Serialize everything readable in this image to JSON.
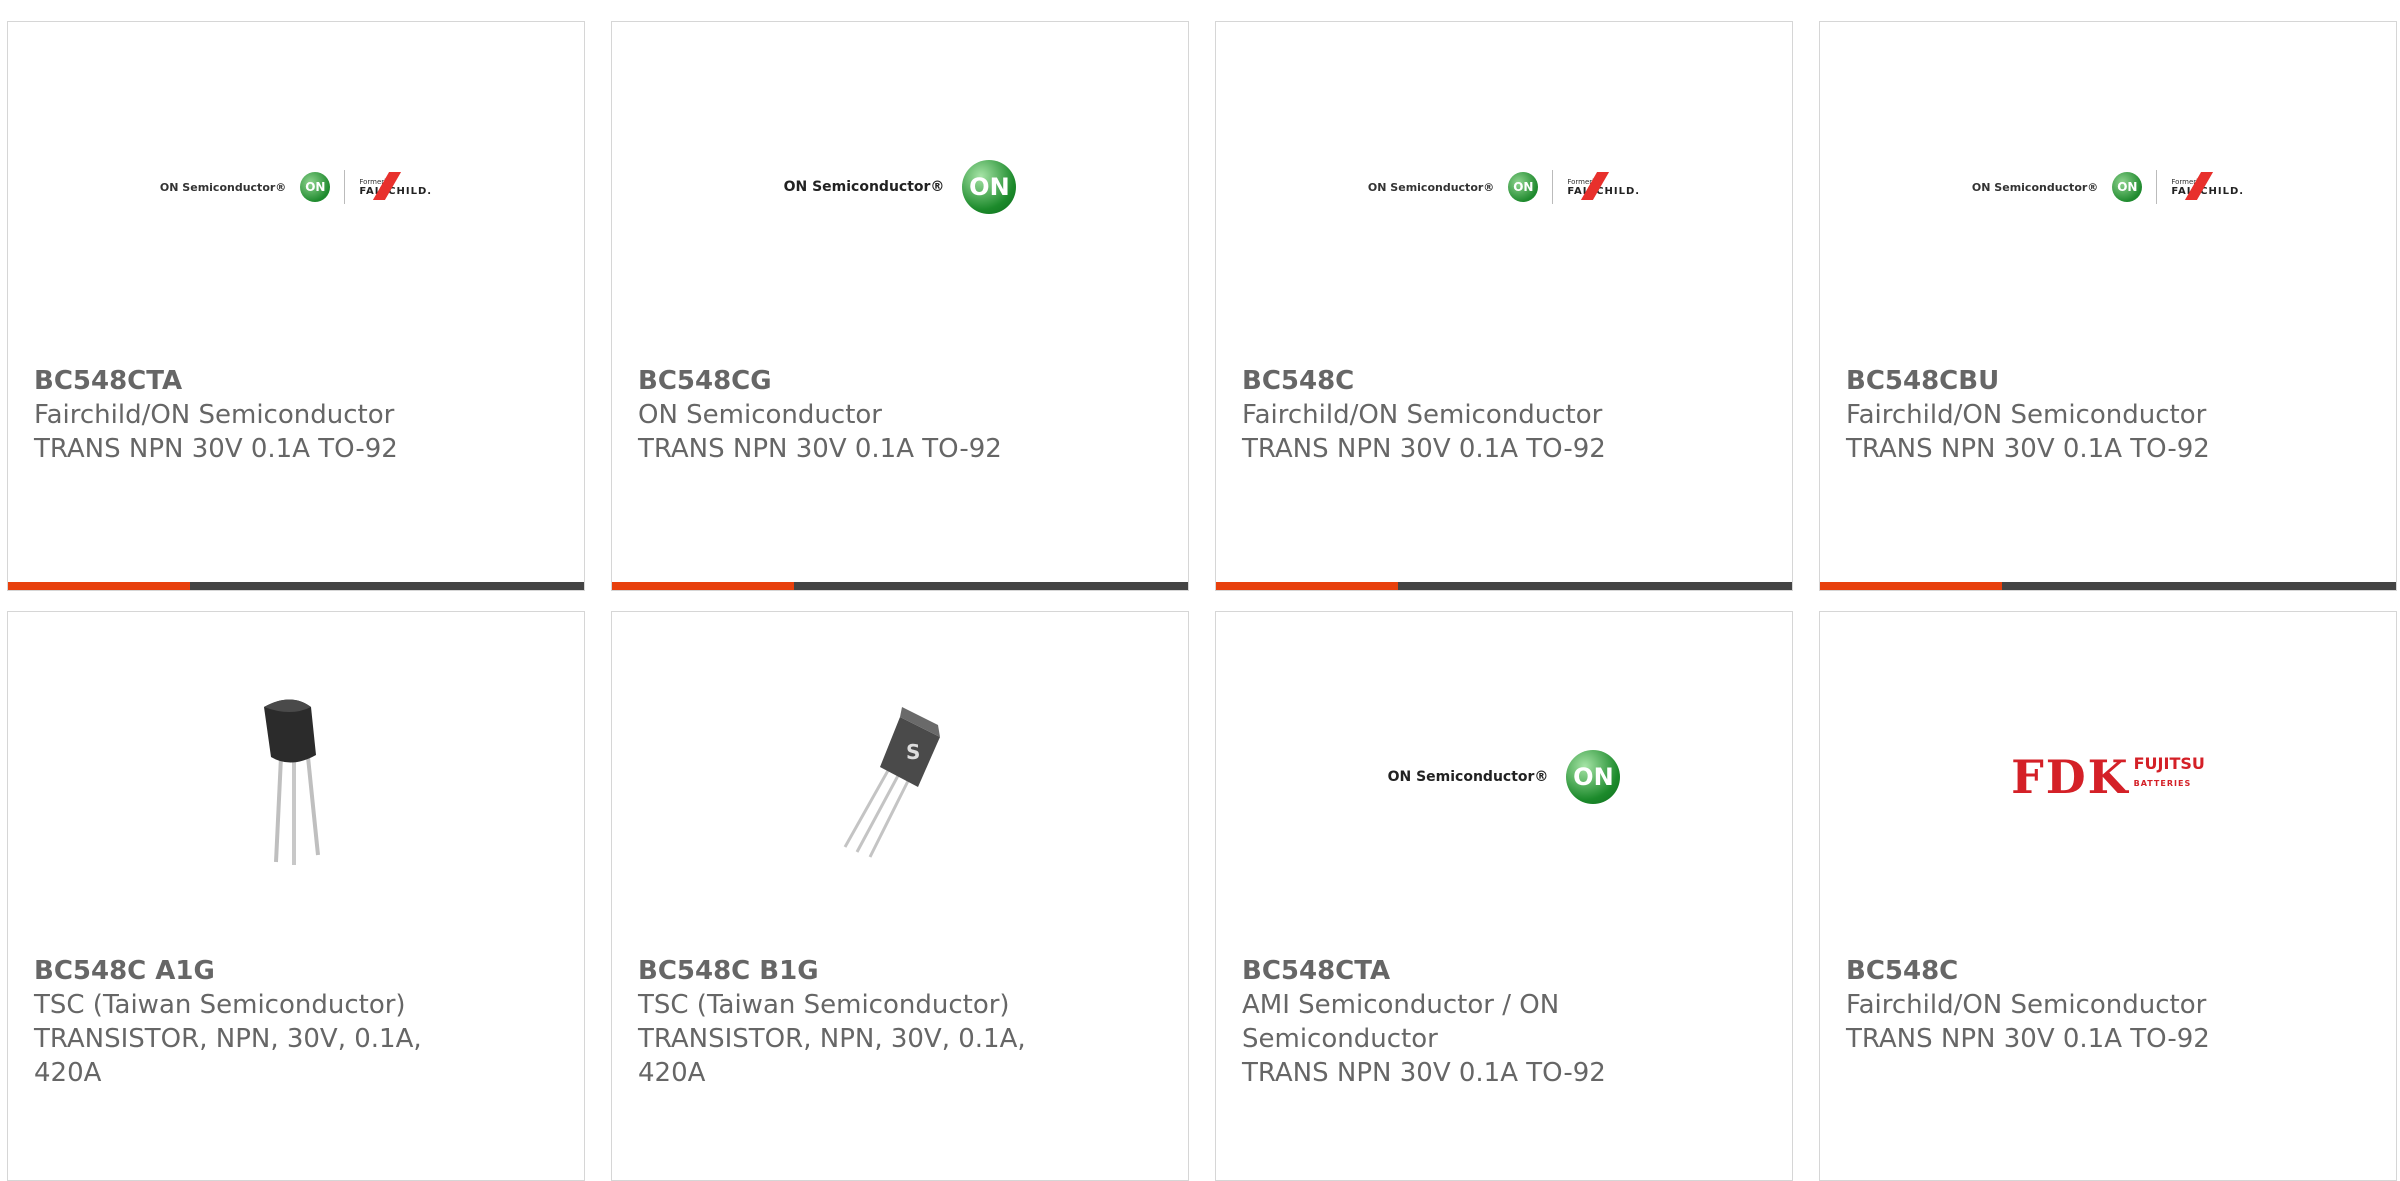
{
  "products": [
    {
      "part": "BC548CTA",
      "mfr": "Fairchild/ON Semiconductor",
      "desc": "TRANS NPN 30V 0.1A TO-92",
      "logo": "onsemi-fairchild-logo"
    },
    {
      "part": "BC548CG",
      "mfr": "ON Semiconductor",
      "desc": "TRANS NPN 30V 0.1A TO-92",
      "logo": "onsemi-logo"
    },
    {
      "part": "BC548C",
      "mfr": "Fairchild/ON Semiconductor",
      "desc": "TRANS NPN 30V 0.1A TO-92",
      "logo": "onsemi-fairchild-logo"
    },
    {
      "part": "BC548CBU",
      "mfr": "Fairchild/ON Semiconductor",
      "desc": "TRANS NPN 30V 0.1A TO-92",
      "logo": "onsemi-fairchild-logo"
    },
    {
      "part": "BC548C A1G",
      "mfr": "TSC (Taiwan Semiconductor)",
      "desc": "TRANSISTOR, NPN, 30V, 0.1A, 420A",
      "logo": "transistor-photo"
    },
    {
      "part": "BC548C B1G",
      "mfr": "TSC (Taiwan Semiconductor)",
      "desc": "TRANSISTOR, NPN, 30V, 0.1A, 420A",
      "logo": "transistor-photo-2"
    },
    {
      "part": "BC548CTA",
      "mfr": "AMI Semiconductor / ON Semiconductor",
      "desc": "TRANS NPN 30V 0.1A TO-92",
      "logo": "onsemi-logo"
    },
    {
      "part": "BC548C",
      "mfr": "Fairchild/ON Semiconductor",
      "desc": "TRANS NPN 30V 0.1A TO-92",
      "logo": "fdk-fujitsu-logo"
    }
  ],
  "logos": {
    "onf_text": "ON Semiconductor®",
    "on_mark": "ON",
    "formerly": "Formerly",
    "fairchild": "FAIRCHILD.",
    "on_text": "ON Semiconductor®",
    "fdk": "FDK",
    "fujitsu": "FUJITSU",
    "batteries": "BATTERIES"
  },
  "colors": {
    "accent": "#e8400c",
    "bar": "#444444",
    "text": "#666666",
    "border": "#d6d6d6"
  }
}
